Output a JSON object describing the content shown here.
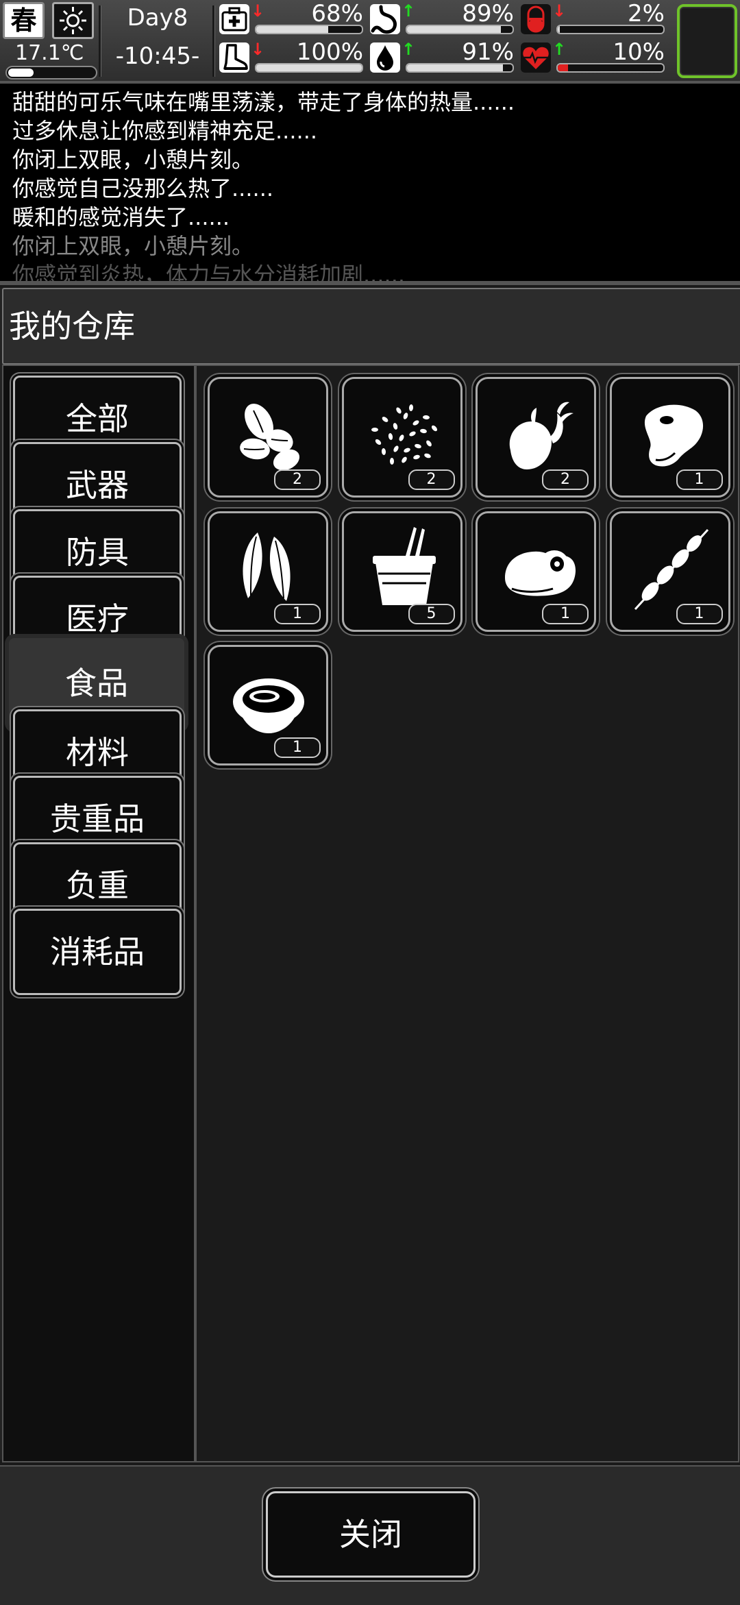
{
  "status": {
    "season": "春",
    "temperature": "17.1℃",
    "temperature_level": 0.3,
    "day": "Day8",
    "time": "-10:45-",
    "stats": [
      {
        "name": "health",
        "icon": "medkit-icon",
        "arrow": "↓",
        "arrow_color": "#ff2a2a",
        "value": "68%",
        "level": 0.68,
        "bar_color": "#dddddd"
      },
      {
        "name": "hunger",
        "icon": "stomach-icon",
        "arrow": "↑",
        "arrow_color": "#22dd22",
        "value": "89%",
        "level": 0.89,
        "bar_color": "#dddddd"
      },
      {
        "name": "illness",
        "icon": "pill-icon",
        "arrow": "↓",
        "arrow_color": "#ff2a2a",
        "value": "2%",
        "level": 0.02,
        "bar_color": "#dddddd"
      },
      {
        "name": "stamina",
        "icon": "boot-icon",
        "arrow": "↓",
        "arrow_color": "#ff2a2a",
        "value": "100%",
        "level": 1.0,
        "bar_color": "#dddddd"
      },
      {
        "name": "thirst",
        "icon": "water-drop-icon",
        "arrow": "↑",
        "arrow_color": "#22dd22",
        "value": "91%",
        "level": 0.91,
        "bar_color": "#dddddd"
      },
      {
        "name": "heart",
        "icon": "heart-icon",
        "arrow": "↑",
        "arrow_color": "#22dd22",
        "value": "10%",
        "level": 0.1,
        "bar_color": "#e02020"
      }
    ]
  },
  "messages": [
    {
      "text": "甜甜的可乐气味在嘴里荡漾，带走了身体的热量......",
      "color": "#ffffff"
    },
    {
      "text": "过多休息让你感到精神充足......",
      "color": "#ffffff"
    },
    {
      "text": "你闭上双眼，小憩片刻。",
      "color": "#ffffff"
    },
    {
      "text": "你感觉自己没那么热了......",
      "color": "#ffffff"
    },
    {
      "text": "暖和的感觉消失了......",
      "color": "#ffffff"
    },
    {
      "text": "你闭上双眼，小憩片刻。",
      "color": "#888888"
    },
    {
      "text": "你感觉到炎热，体力与水分消耗加剧......",
      "color": "#555555"
    }
  ],
  "storage": {
    "title": "我的仓库",
    "categories": [
      {
        "label": "全部",
        "active": false
      },
      {
        "label": "武器",
        "active": false
      },
      {
        "label": "防具",
        "active": false
      },
      {
        "label": "医疗",
        "active": false
      },
      {
        "label": "食品",
        "active": true
      },
      {
        "label": "材料",
        "active": false
      },
      {
        "label": "贵重品",
        "active": false
      },
      {
        "label": "负重",
        "active": false
      },
      {
        "label": "消耗品",
        "active": false
      }
    ],
    "items": [
      {
        "icon": "almond-icon",
        "count": "2"
      },
      {
        "icon": "rice-grains-icon",
        "count": "2"
      },
      {
        "icon": "sprouted-potato-icon",
        "count": "2"
      },
      {
        "icon": "steak-icon",
        "count": "1"
      },
      {
        "icon": "seeds-icon",
        "count": "1"
      },
      {
        "icon": "cup-noodles-icon",
        "count": "5"
      },
      {
        "icon": "meat-chunk-icon",
        "count": "1"
      },
      {
        "icon": "meat-skewer-icon",
        "count": "1"
      },
      {
        "icon": "soup-bowl-icon",
        "count": "1"
      }
    ]
  },
  "close_label": "关闭"
}
